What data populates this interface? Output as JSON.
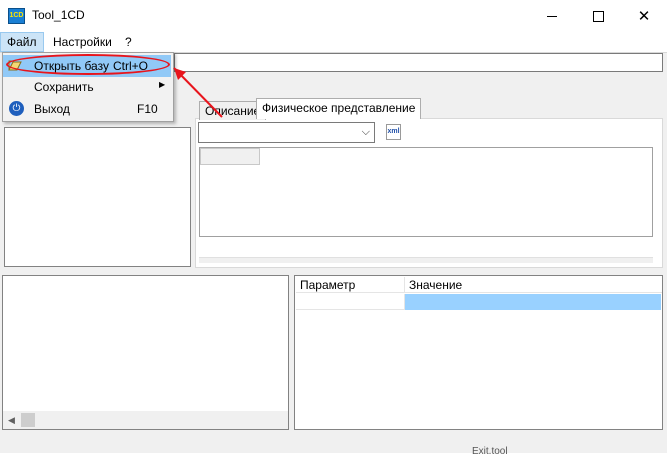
{
  "window": {
    "title": "Tool_1CD",
    "icon_text": "1CD",
    "minimize_icon": "minimize-icon",
    "maximize_icon": "maximize-icon",
    "close_glyph": "✕"
  },
  "menubar": {
    "items": [
      "Файл",
      "Настройки",
      "?"
    ]
  },
  "file_menu": {
    "items": [
      {
        "label": "Открыть базу",
        "shortcut": "Ctrl+O",
        "icon": "open-database-icon",
        "highlighted": true
      },
      {
        "label": "Сохранить",
        "shortcut": "",
        "icon": "",
        "has_submenu": true
      },
      {
        "label": "Выход",
        "shortcut": "F10",
        "icon": "power-icon"
      }
    ],
    "submenu_glyph": "▶"
  },
  "tabs": [
    "Описание",
    "Физическое представление"
  ],
  "combo": {
    "value": "",
    "arrow_glyph": "⌵"
  },
  "xml_button": {
    "text": "xml"
  },
  "params_table": {
    "columns": [
      "Параметр",
      "Значение"
    ]
  },
  "scroll": {
    "left_glyph": "◀"
  },
  "taskbar_peek": "Exit.tool",
  "colors": {
    "menu_highlight": "#91c9f7",
    "annotation": "#e8141c",
    "selected_row": "#99d1ff"
  }
}
